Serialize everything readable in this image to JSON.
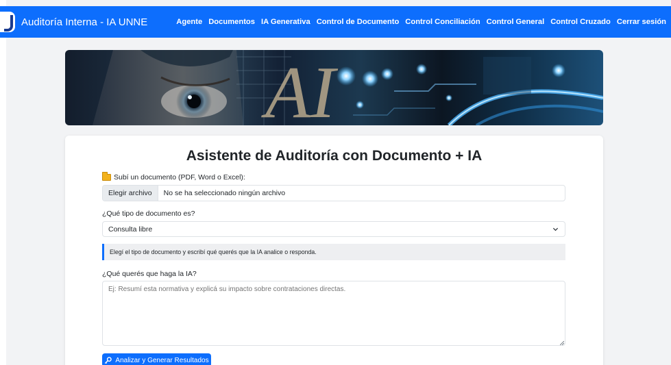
{
  "navbar": {
    "brand": "Auditoría Interna - IA UNNE",
    "links": [
      "Agente",
      "Documentos",
      "IA Generativa",
      "Control de Documento",
      "Control Conciliación",
      "Control General",
      "Control Cruzado",
      "Cerrar sesión"
    ]
  },
  "banner": {
    "text": "AI"
  },
  "form": {
    "title": "Asistente de Auditoría con Documento + IA",
    "upload_label": "Subí un documento (PDF, Word o Excel):",
    "file_button": "Elegir archivo",
    "file_status": "No se ha seleccionado ningún archivo",
    "type_label": "¿Qué tipo de documento es?",
    "type_selected": "Consulta libre",
    "info": "Elegí el tipo de documento y escribí qué querés que la IA analice o responda.",
    "prompt_label": "¿Qué querés que haga la IA?",
    "prompt_placeholder": "Ej: Resumí esta normativa y explicá su impacto sobre contrataciones directas.",
    "submit": "Analizar y Generar Resultados"
  },
  "colors": {
    "primary": "#0d6efd",
    "background": "#f2f3f5",
    "folder": "#f3b21c"
  }
}
